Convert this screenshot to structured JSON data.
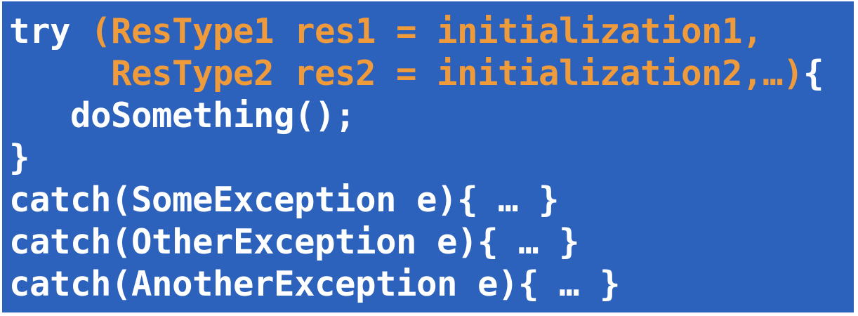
{
  "code": {
    "line1": {
      "keyword": "try",
      "resources": " (ResType1 res1 = initialization1,"
    },
    "line2": {
      "indent": "     ",
      "resources": "ResType2 res2 = initialization2,…)",
      "brace": "{"
    },
    "line3": "   doSomething();",
    "line4": "}",
    "line5": "catch(SomeException e){ … }",
    "line6": "catch(OtherException e){ … }",
    "line7": "catch(AnotherException e){ … }"
  },
  "colors": {
    "background": "#2c62bb",
    "resource_text": "#ef9a3b",
    "code_text": "#ffffff"
  }
}
